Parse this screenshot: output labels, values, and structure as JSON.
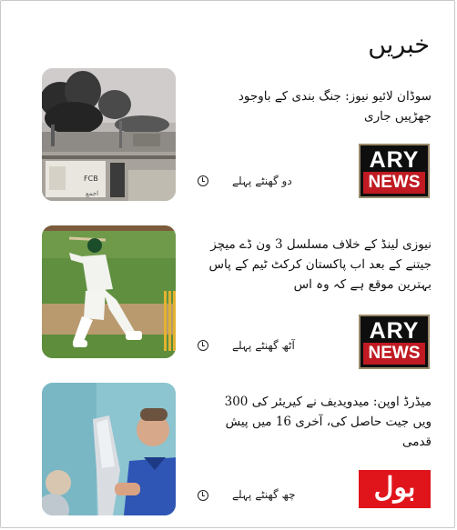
{
  "header": {
    "title": "خبریں"
  },
  "stories": [
    {
      "headline": "سوڈان لائیو نیوز: جنگ بندی کے باوجود جھڑپیں جاری",
      "time": "دو گھنٹے پہلے",
      "source": {
        "ary": "ARY",
        "news": "NEWS"
      }
    },
    {
      "headline": "نیوزی لینڈ کے خلاف مسلسل 3 ون ڈے میچز جیتنے کے بعد اب پاکستان کرکٹ ٹیم کے پاس بہترین موقع ہے کہ وہ اس",
      "time": "آٹھ گھنٹے پہلے",
      "source": {
        "ary": "ARY",
        "news": "NEWS"
      }
    },
    {
      "headline": "میڈرڈ اوپن: میدویدیف نے کیریئر کی 300 ویں جیت حاصل کی، آخری 16 میں پیش قدمی",
      "time": "چھ گھنٹے پہلے",
      "source": {
        "label": "بول"
      }
    }
  ],
  "thumb_overlay": {
    "sign1": "FCB",
    "sign2": "اجمع"
  },
  "colors": {
    "ary_red": "#c01a22",
    "bol_red": "#e0151b"
  }
}
